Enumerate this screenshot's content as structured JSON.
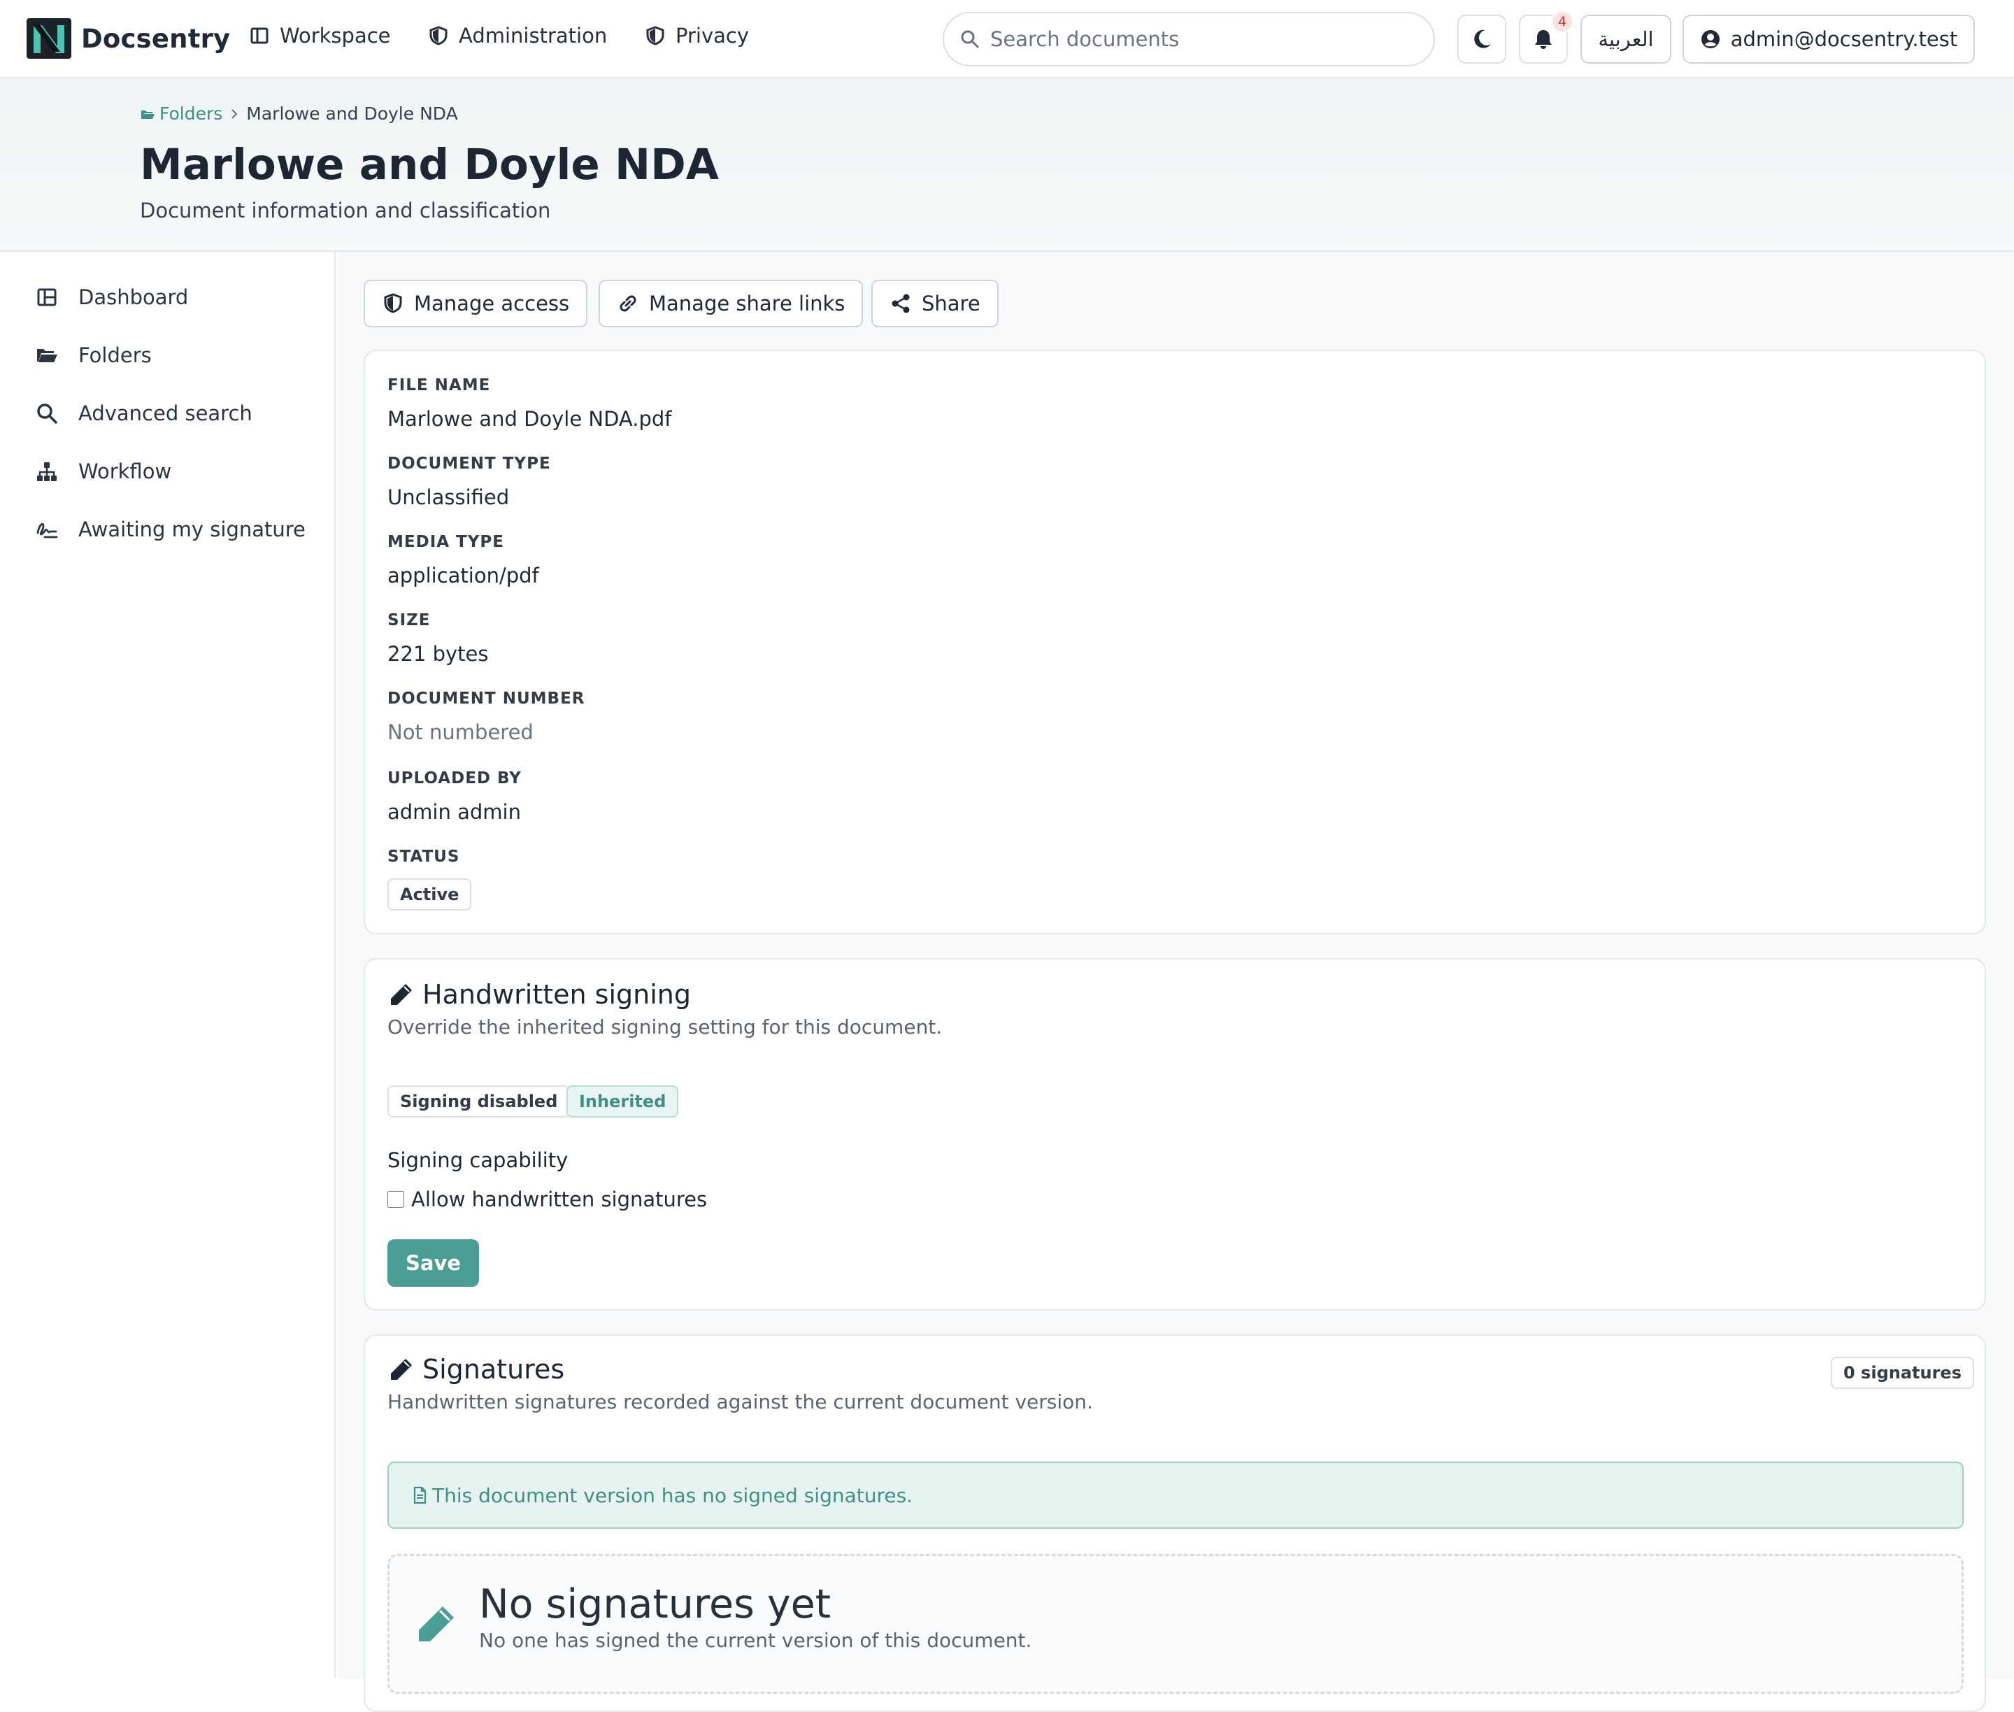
{
  "app": {
    "name": "Docsentry"
  },
  "nav": {
    "workspace": "Workspace",
    "administration": "Administration",
    "privacy": "Privacy",
    "search_placeholder": "Search documents",
    "notifications_count": "4",
    "language": "العربية",
    "user": "admin@docsentry.test"
  },
  "breadcrumb": {
    "root": "Folders",
    "current": "Marlowe and Doyle NDA"
  },
  "header": {
    "title": "Marlowe and Doyle NDA",
    "subtitle": "Document information and classification"
  },
  "sidebar": {
    "items": [
      {
        "label": "Dashboard",
        "icon": "dashboard-icon"
      },
      {
        "label": "Folders",
        "icon": "folder-open-icon"
      },
      {
        "label": "Advanced search",
        "icon": "search-icon"
      },
      {
        "label": "Workflow",
        "icon": "sitemap-icon"
      },
      {
        "label": "Awaiting my signature",
        "icon": "signature-icon"
      }
    ]
  },
  "actions": {
    "manage_access": "Manage access",
    "manage_share_links": "Manage share links",
    "share": "Share"
  },
  "details": {
    "file_name_label": "FILE NAME",
    "file_name": "Marlowe and Doyle NDA.pdf",
    "doc_type_label": "DOCUMENT TYPE",
    "doc_type": "Unclassified",
    "media_type_label": "MEDIA TYPE",
    "media_type": "application/pdf",
    "size_label": "SIZE",
    "size": "221 bytes",
    "doc_number_label": "DOCUMENT NUMBER",
    "doc_number": "Not numbered",
    "uploaded_by_label": "UPLOADED BY",
    "uploaded_by": "admin admin",
    "status_label": "STATUS",
    "status": "Active"
  },
  "signing": {
    "title": "Handwritten signing",
    "description": "Override the inherited signing setting for this document.",
    "state_badge": "Signing disabled",
    "source_badge": "Inherited",
    "capability_label": "Signing capability",
    "checkbox_label": "Allow handwritten signatures",
    "checkbox_checked": false,
    "save_label": "Save"
  },
  "signatures": {
    "title": "Signatures",
    "description": "Handwritten signatures recorded against the current document version.",
    "count_badge": "0 signatures",
    "alert": "This document version has no signed signatures.",
    "empty_title": "No signatures yet",
    "empty_desc": "No one has signed the current version of this document."
  },
  "colors": {
    "accent": "#4a9e96",
    "accent_text": "#3f8f86",
    "alert_bg": "#e6f3f1",
    "notification_badge": "#fde2e2"
  }
}
